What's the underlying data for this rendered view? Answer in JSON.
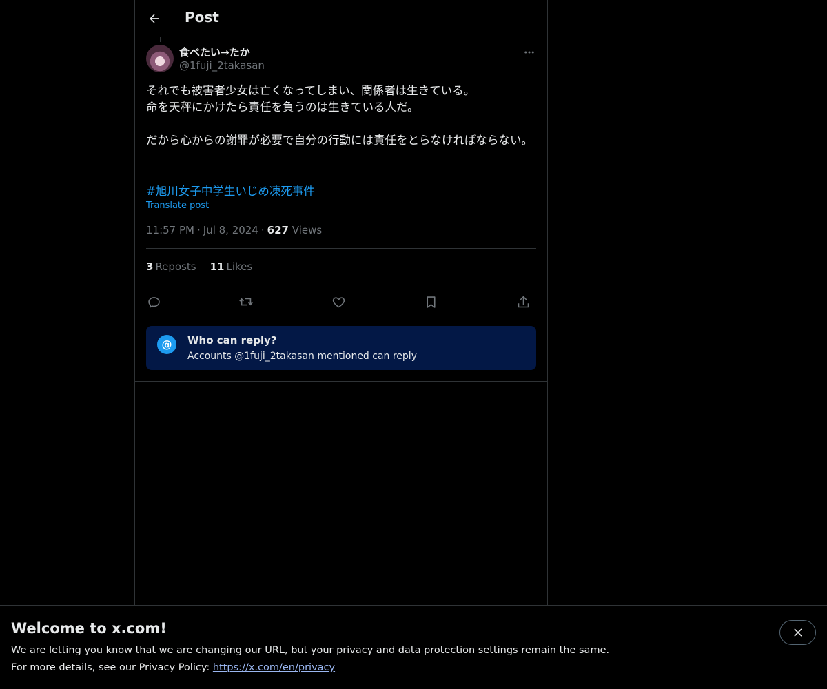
{
  "header": {
    "title": "Post",
    "back_icon": "arrow-left-icon"
  },
  "post": {
    "display_name": "食べたい→たか",
    "handle": "@1fuji_2takasan",
    "text": "それでも被害者少女は亡くなってしまい、関係者は生きている。\n命を天秤にかけたら責任を負うのは生きている人だ。\n\nだから心からの謝罪が必要で自分の行動には責任をとらなければならない。",
    "hashtag": "#旭川女子中学生いじめ凍死事件",
    "translate_label": "Translate post",
    "time": "11:57 PM",
    "date": "Jul 8, 2024",
    "separator": "·",
    "views_count": "627",
    "views_label": "Views",
    "reposts_count": "3",
    "reposts_label": "Reposts",
    "likes_count": "11",
    "likes_label": "Likes"
  },
  "actions": {
    "reply_icon": "reply-icon",
    "repost_icon": "repost-icon",
    "like_icon": "heart-icon",
    "bookmark_icon": "bookmark-icon",
    "share_icon": "share-icon"
  },
  "reply_restriction": {
    "icon_glyph": "@",
    "title": "Who can reply?",
    "subtitle": "Accounts @1fuji_2takasan mentioned can reply"
  },
  "banner": {
    "title": "Welcome to x.com!",
    "line1": "We are letting you know that we are changing our URL, but your privacy and data protection settings remain the same.",
    "line2_prefix": "For more details, see our Privacy Policy: ",
    "link_text": "https://x.com/en/privacy",
    "close_icon": "close-icon"
  },
  "colors": {
    "background": "#000000",
    "text": "#e7e9ea",
    "muted": "#71767b",
    "accent": "#1d9bf0",
    "reply_box": "#031846",
    "border": "#2f3336"
  }
}
